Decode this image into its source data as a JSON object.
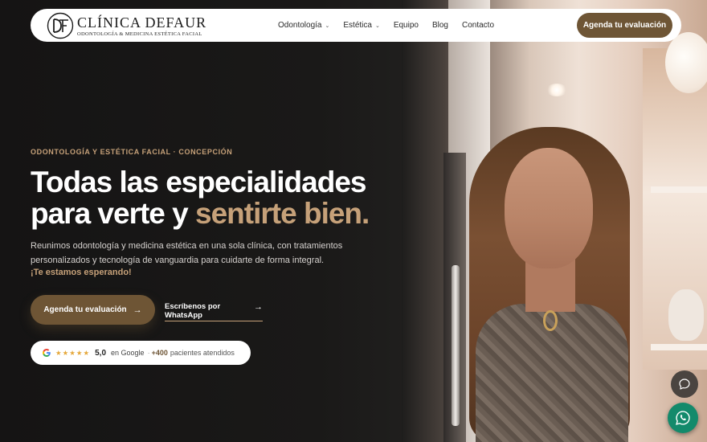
{
  "brand": {
    "name": "CLÍNICA DEFAUR",
    "tagline": "ODONTOLOGÍA & MEDICINA ESTÉTICA FACIAL",
    "accent_color": "#c6a179",
    "button_color": "#6e5535"
  },
  "nav": {
    "items": [
      {
        "label": "Odontología",
        "has_dropdown": true
      },
      {
        "label": "Estética",
        "has_dropdown": true
      },
      {
        "label": "Equipo",
        "has_dropdown": false
      },
      {
        "label": "Blog",
        "has_dropdown": false
      },
      {
        "label": "Contacto",
        "has_dropdown": false
      }
    ],
    "cta_label": "Agenda tu evaluación"
  },
  "hero": {
    "eyebrow": "ODONTOLOGÍA Y ESTÉTICA FACIAL · CONCEPCIÓN",
    "headline_line1": "Todas las especialidades",
    "headline_line2_plain": "para verte y ",
    "headline_line2_accent": "sentirte bien.",
    "description": "Reunimos odontología y medicina estética en una sola clínica, con tratamientos personalizados y tecnología de vanguardia para cuidarte de forma integral.",
    "invite": "¡Te estamos esperando!",
    "primary_cta": "Agenda tu evaluación",
    "secondary_cta": "Escríbenos por WhatsApp"
  },
  "rating": {
    "stars": "★★★★★",
    "score": "5,0",
    "source": "en Google",
    "separator": "·",
    "count": "+400",
    "count_label": "pacientes atendidos"
  },
  "icons": {
    "arrow": "→",
    "chevron": "⌄",
    "chat": "chat-bubble-icon",
    "whatsapp": "whatsapp-icon",
    "google": "google-g-icon"
  }
}
